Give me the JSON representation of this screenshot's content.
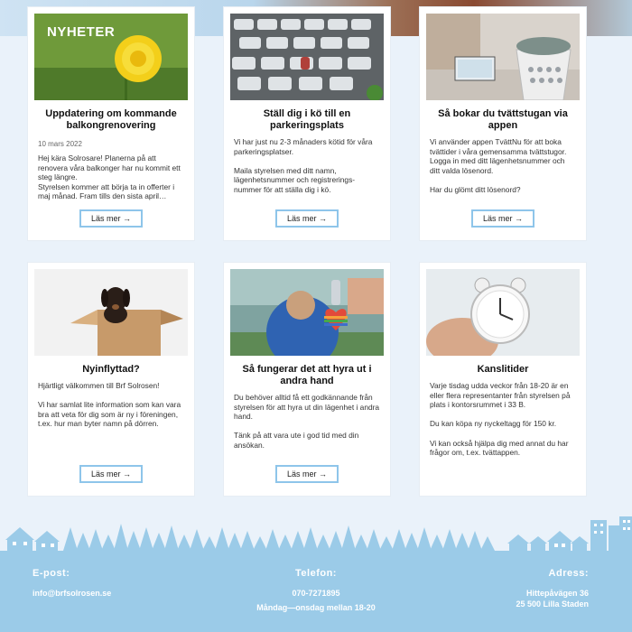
{
  "cards": [
    {
      "overlay": "NYHETER",
      "title": "Uppdatering om kommande balkongrenovering",
      "date": "10 mars 2022",
      "text": "Hej kära Solrosare! Planerna på att renovera våra balkonger har nu kommit ett steg längre.\nStyrelsen kommer att börja ta in offerter i maj månad. Fram tills den sista april…",
      "button": "Läs mer →"
    },
    {
      "title": "Ställ dig i kö till en parkeringsplats",
      "text": "Vi har just nu 2-3 månaders kötid för våra parkeringsplatser.\n\nMaila styrelsen med ditt namn, lägenhetsnummer och registrerings-nummer för att ställa dig i kö.",
      "button": "Läs mer →"
    },
    {
      "title": "Så bokar du tvättstugan via appen",
      "text": "Vi använder appen TvättNu för att boka tvättider i våra gemensamma tvättstugor. Logga in med ditt lägenhetsnummer och ditt valda lösenord.\n\nHar du glömt ditt lösenord?",
      "button": "Läs mer →"
    },
    {
      "title": "Nyinflyttad?",
      "text": "Hjärtligt välkommen till Brf Solrosen!\n\nVi har samlat lite information som kan vara bra att veta för dig som är ny i föreningen, t.ex. hur man byter namn på dörren.",
      "button": "Läs mer →"
    },
    {
      "title": "Så fungerar det att hyra ut i andra hand",
      "text": "Du behöver alltid få ett godkännande från styrelsen för att hyra ut din lägenhet i andra hand.\n\nTänk på att vara ute i god tid med din ansökan.",
      "button": "Läs mer →"
    },
    {
      "title": "Kanslitider",
      "text": "Varje tisdag udda veckor från 18-20 är en eller flera representanter från styrelsen på plats i kontorsrummet i 33 B.\n\nDu kan köpa ny nyckeltagg för 150 kr.\n\nVi kan också hjälpa dig med annat du har frågor om, t.ex. tvättappen."
    }
  ],
  "footer": {
    "email_label": "E-post:",
    "email": "info@brfsolrosen.se",
    "phone_label": "Telefon:",
    "phone": "070-7271895",
    "phone_hours": "Måndag—onsdag mellan 18-20",
    "address_label": "Adress:",
    "address_line1": "Hittepåvägen 36",
    "address_line2": "25 500 Lilla Staden"
  },
  "colors": {
    "accent": "#8ec5ea",
    "footer": "#9bcbe8",
    "background": "#eaf2fa"
  },
  "icons": [
    "arrow-right-icon"
  ]
}
